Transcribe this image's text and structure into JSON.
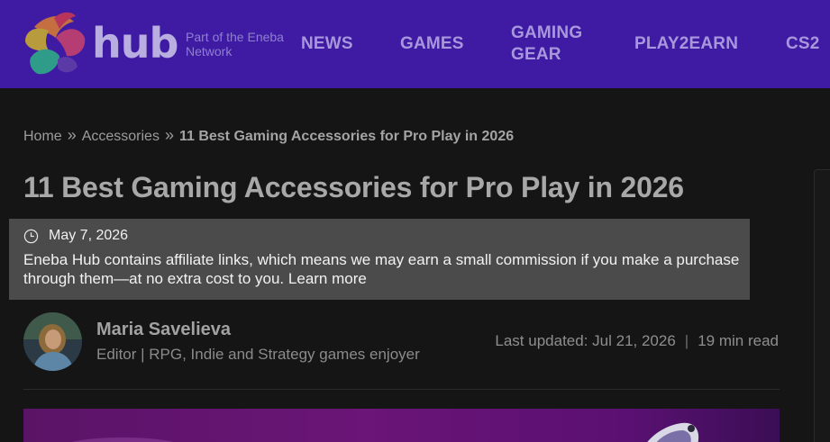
{
  "header": {
    "logo_text": "hub",
    "tagline": "Part of the Eneba Network",
    "nav": [
      {
        "label": "NEWS"
      },
      {
        "label": "GAMES"
      },
      {
        "label": "GAMING GEAR"
      },
      {
        "label": "PLAY2EARN"
      },
      {
        "label": "CS2"
      }
    ]
  },
  "breadcrumb": {
    "home": "Home",
    "category": "Accessories",
    "current": "11 Best Gaming Accessories for Pro Play in 2026"
  },
  "article": {
    "title": "11 Best Gaming Accessories for Pro Play in 2026",
    "date": "May 7, 2026",
    "affiliate_notice": "Eneba Hub contains affiliate links, which means we may earn a small commission if you make a purchase through them—at no extra cost to you.",
    "learn_more": "Learn more"
  },
  "author": {
    "name": "Maria Savelieva",
    "role": "Editor | RPG, Indie and Strategy games enjoyer"
  },
  "meta": {
    "last_updated_label": "Last updated:",
    "last_updated": "Jul 21, 2026",
    "separator": "|",
    "read_time": "19 min read"
  },
  "colors": {
    "header_bg": "#3f1ba3",
    "page_bg": "#151515",
    "notice_bg": "#4b4b4b"
  }
}
